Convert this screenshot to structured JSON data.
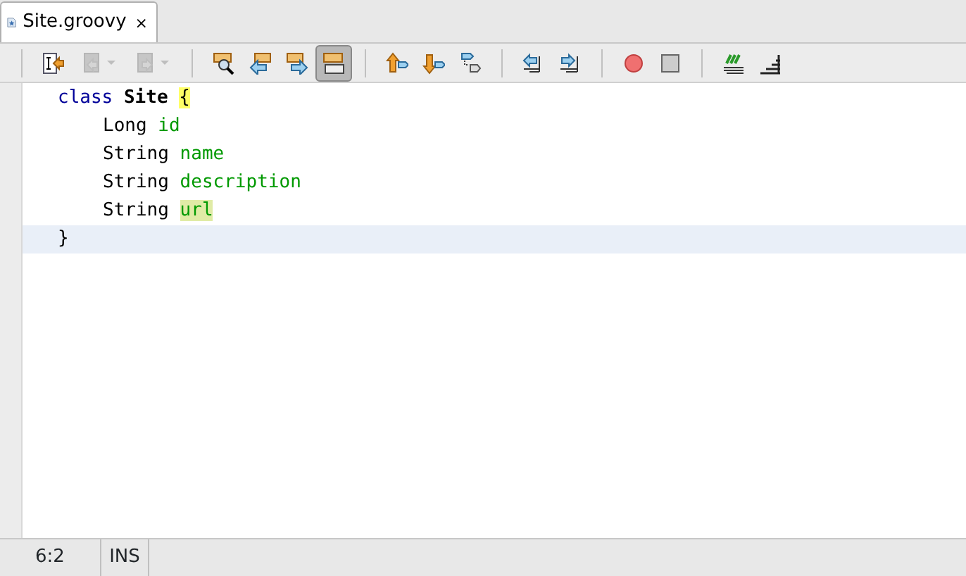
{
  "tab": {
    "label": "Site.groovy",
    "selected": true,
    "close": "×"
  },
  "toolbar": [
    [
      {
        "kind": "button",
        "disabled": false,
        "selected": false
      },
      {
        "kind": "dropdown",
        "disabled": true,
        "selected": false
      },
      {
        "kind": "dropdown",
        "disabled": true,
        "selected": false
      }
    ],
    [
      {
        "kind": "button",
        "disabled": false,
        "selected": false
      },
      {
        "kind": "button",
        "disabled": false,
        "selected": false
      },
      {
        "kind": "button",
        "disabled": false,
        "selected": false
      },
      {
        "kind": "button",
        "disabled": false,
        "selected": true
      }
    ],
    [
      {
        "kind": "button",
        "disabled": false,
        "selected": false
      },
      {
        "kind": "button",
        "disabled": false,
        "selected": false
      },
      {
        "kind": "button",
        "disabled": false,
        "selected": false
      }
    ],
    [
      {
        "kind": "button",
        "disabled": false,
        "selected": false
      },
      {
        "kind": "button",
        "disabled": false,
        "selected": false
      }
    ],
    [
      {
        "kind": "button",
        "disabled": false,
        "selected": false
      },
      {
        "kind": "button",
        "disabled": false,
        "selected": false
      }
    ],
    [
      {
        "kind": "button",
        "disabled": false,
        "selected": false
      },
      {
        "kind": "button",
        "disabled": false,
        "selected": false
      }
    ]
  ],
  "code": [
    {
      "current": false,
      "tokens": [
        {
          "kind": "keyword",
          "text": "class"
        },
        {
          "kind": "classname",
          "text": "Site"
        },
        {
          "kind": "brace",
          "text": "{",
          "highlight": true
        }
      ],
      "children": [
        {
          "current": false,
          "tokens": [
            {
              "kind": "type",
              "text": "Long"
            },
            {
              "kind": "field",
              "text": "id",
              "highlight": false
            }
          ]
        },
        {
          "current": false,
          "tokens": [
            {
              "kind": "type",
              "text": "String"
            },
            {
              "kind": "field",
              "text": "name",
              "highlight": false
            }
          ]
        },
        {
          "current": false,
          "tokens": [
            {
              "kind": "type",
              "text": "String"
            },
            {
              "kind": "field",
              "text": "description",
              "highlight": false
            }
          ]
        },
        {
          "current": false,
          "tokens": [
            {
              "kind": "type",
              "text": "String"
            },
            {
              "kind": "field",
              "text": "url",
              "highlight": true
            }
          ]
        }
      ]
    },
    {
      "current": true,
      "tokens": [
        {
          "kind": "brace",
          "text": "}",
          "highlight": false
        }
      ]
    }
  ],
  "status_bar": {
    "position": "6:2",
    "mode": "INS"
  }
}
